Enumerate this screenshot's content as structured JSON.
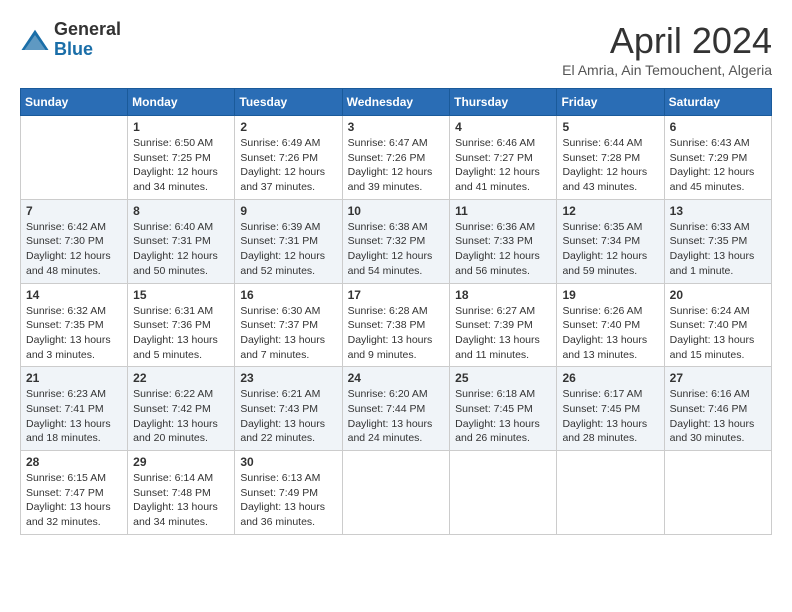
{
  "header": {
    "logo_general": "General",
    "logo_blue": "Blue",
    "month_title": "April 2024",
    "location": "El Amria, Ain Temouchent, Algeria"
  },
  "weekdays": [
    "Sunday",
    "Monday",
    "Tuesday",
    "Wednesday",
    "Thursday",
    "Friday",
    "Saturday"
  ],
  "weeks": [
    [
      {
        "day": null
      },
      {
        "day": "1",
        "sunrise": "6:50 AM",
        "sunset": "7:25 PM",
        "daylight": "12 hours and 34 minutes."
      },
      {
        "day": "2",
        "sunrise": "6:49 AM",
        "sunset": "7:26 PM",
        "daylight": "12 hours and 37 minutes."
      },
      {
        "day": "3",
        "sunrise": "6:47 AM",
        "sunset": "7:26 PM",
        "daylight": "12 hours and 39 minutes."
      },
      {
        "day": "4",
        "sunrise": "6:46 AM",
        "sunset": "7:27 PM",
        "daylight": "12 hours and 41 minutes."
      },
      {
        "day": "5",
        "sunrise": "6:44 AM",
        "sunset": "7:28 PM",
        "daylight": "12 hours and 43 minutes."
      },
      {
        "day": "6",
        "sunrise": "6:43 AM",
        "sunset": "7:29 PM",
        "daylight": "12 hours and 45 minutes."
      }
    ],
    [
      {
        "day": "7",
        "sunrise": "6:42 AM",
        "sunset": "7:30 PM",
        "daylight": "12 hours and 48 minutes."
      },
      {
        "day": "8",
        "sunrise": "6:40 AM",
        "sunset": "7:31 PM",
        "daylight": "12 hours and 50 minutes."
      },
      {
        "day": "9",
        "sunrise": "6:39 AM",
        "sunset": "7:31 PM",
        "daylight": "12 hours and 52 minutes."
      },
      {
        "day": "10",
        "sunrise": "6:38 AM",
        "sunset": "7:32 PM",
        "daylight": "12 hours and 54 minutes."
      },
      {
        "day": "11",
        "sunrise": "6:36 AM",
        "sunset": "7:33 PM",
        "daylight": "12 hours and 56 minutes."
      },
      {
        "day": "12",
        "sunrise": "6:35 AM",
        "sunset": "7:34 PM",
        "daylight": "12 hours and 59 minutes."
      },
      {
        "day": "13",
        "sunrise": "6:33 AM",
        "sunset": "7:35 PM",
        "daylight": "13 hours and 1 minute."
      }
    ],
    [
      {
        "day": "14",
        "sunrise": "6:32 AM",
        "sunset": "7:35 PM",
        "daylight": "13 hours and 3 minutes."
      },
      {
        "day": "15",
        "sunrise": "6:31 AM",
        "sunset": "7:36 PM",
        "daylight": "13 hours and 5 minutes."
      },
      {
        "day": "16",
        "sunrise": "6:30 AM",
        "sunset": "7:37 PM",
        "daylight": "13 hours and 7 minutes."
      },
      {
        "day": "17",
        "sunrise": "6:28 AM",
        "sunset": "7:38 PM",
        "daylight": "13 hours and 9 minutes."
      },
      {
        "day": "18",
        "sunrise": "6:27 AM",
        "sunset": "7:39 PM",
        "daylight": "13 hours and 11 minutes."
      },
      {
        "day": "19",
        "sunrise": "6:26 AM",
        "sunset": "7:40 PM",
        "daylight": "13 hours and 13 minutes."
      },
      {
        "day": "20",
        "sunrise": "6:24 AM",
        "sunset": "7:40 PM",
        "daylight": "13 hours and 15 minutes."
      }
    ],
    [
      {
        "day": "21",
        "sunrise": "6:23 AM",
        "sunset": "7:41 PM",
        "daylight": "13 hours and 18 minutes."
      },
      {
        "day": "22",
        "sunrise": "6:22 AM",
        "sunset": "7:42 PM",
        "daylight": "13 hours and 20 minutes."
      },
      {
        "day": "23",
        "sunrise": "6:21 AM",
        "sunset": "7:43 PM",
        "daylight": "13 hours and 22 minutes."
      },
      {
        "day": "24",
        "sunrise": "6:20 AM",
        "sunset": "7:44 PM",
        "daylight": "13 hours and 24 minutes."
      },
      {
        "day": "25",
        "sunrise": "6:18 AM",
        "sunset": "7:45 PM",
        "daylight": "13 hours and 26 minutes."
      },
      {
        "day": "26",
        "sunrise": "6:17 AM",
        "sunset": "7:45 PM",
        "daylight": "13 hours and 28 minutes."
      },
      {
        "day": "27",
        "sunrise": "6:16 AM",
        "sunset": "7:46 PM",
        "daylight": "13 hours and 30 minutes."
      }
    ],
    [
      {
        "day": "28",
        "sunrise": "6:15 AM",
        "sunset": "7:47 PM",
        "daylight": "13 hours and 32 minutes."
      },
      {
        "day": "29",
        "sunrise": "6:14 AM",
        "sunset": "7:48 PM",
        "daylight": "13 hours and 34 minutes."
      },
      {
        "day": "30",
        "sunrise": "6:13 AM",
        "sunset": "7:49 PM",
        "daylight": "13 hours and 36 minutes."
      },
      {
        "day": null
      },
      {
        "day": null
      },
      {
        "day": null
      },
      {
        "day": null
      }
    ]
  ],
  "labels": {
    "sunrise": "Sunrise:",
    "sunset": "Sunset:",
    "daylight": "Daylight:"
  }
}
